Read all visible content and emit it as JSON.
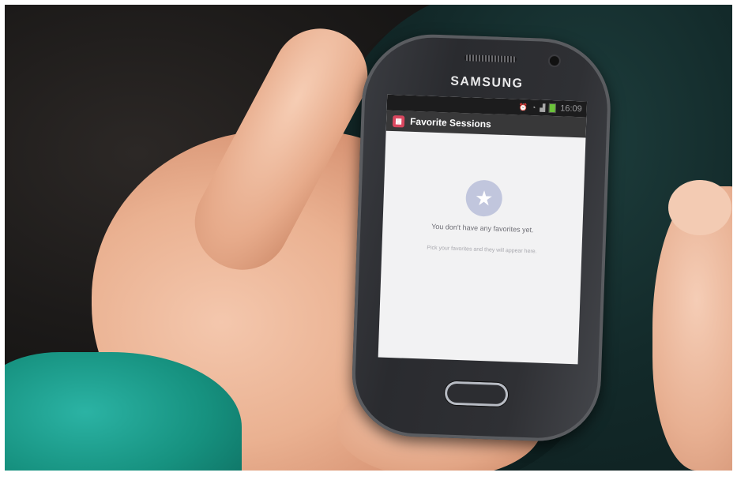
{
  "phone": {
    "brand": "SAMSUNG"
  },
  "status_bar": {
    "icons": [
      "alarm-icon",
      "wifi-icon",
      "signal-icon",
      "battery-icon"
    ],
    "time": "16:09"
  },
  "action_bar": {
    "icon": "calendar-icon",
    "title": "Favorite Sessions"
  },
  "empty_state": {
    "icon": "star-icon",
    "title": "You don't have any favorites yet.",
    "subtitle": "Pick your favorites and they will appear here."
  },
  "colors": {
    "action_bar": "#383839",
    "app_icon": "#d9475f",
    "star_circle": "#c1c6dd",
    "screen_bg": "#f2f2f3"
  }
}
